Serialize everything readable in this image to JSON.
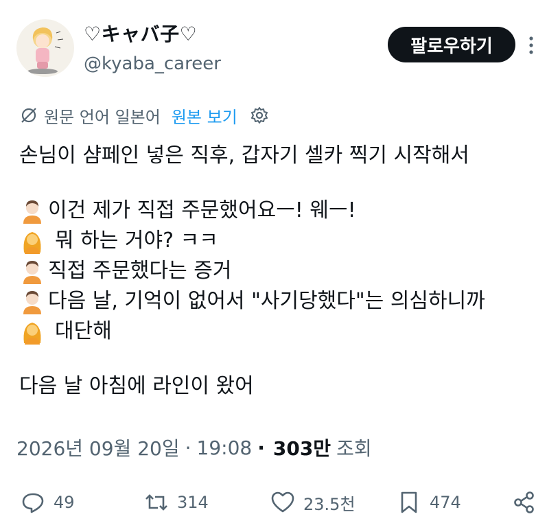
{
  "author": {
    "display_name": "♡キャバ子♡",
    "handle": "@kyaba_career",
    "follow_label": "팔로우하기"
  },
  "translation": {
    "language_note": "원문 언어 일본어",
    "show_original_label": "원본 보기"
  },
  "tweet": {
    "lines": [
      {
        "text": "손님이 샴페인 넣은 직후, 갑자기 셀카 찍기 시작해서"
      },
      {
        "text": ""
      },
      {
        "emoji": "man",
        "text": "이건 제가 직접 주문했어요ㅡ! 웨ㅡ!"
      },
      {
        "emoji": "woman",
        "text": "뭐 하는 거야? ㅋㅋ"
      },
      {
        "emoji": "man",
        "text": "직접 주문했다는 증거"
      },
      {
        "emoji": "man",
        "text": "다음 날, 기억이 없어서 \"사기당했다\"는 의심하니까"
      },
      {
        "emoji": "woman",
        "text": "대단해"
      },
      {
        "text": ""
      },
      {
        "text": "다음 날 아침에 라인이 왔어"
      }
    ]
  },
  "meta": {
    "date": "2026년 09월 20일",
    "separator1": "·",
    "time": "19:08",
    "separator2": "·",
    "views_count": "303만",
    "views_label": "조회"
  },
  "actions": {
    "replies": "49",
    "retweets": "314",
    "likes": "23.5천",
    "bookmarks": "474"
  },
  "colors": {
    "text_primary": "#0f1419",
    "text_secondary": "#536471",
    "link": "#1d9bf0",
    "follow_bg": "#0f1419"
  }
}
